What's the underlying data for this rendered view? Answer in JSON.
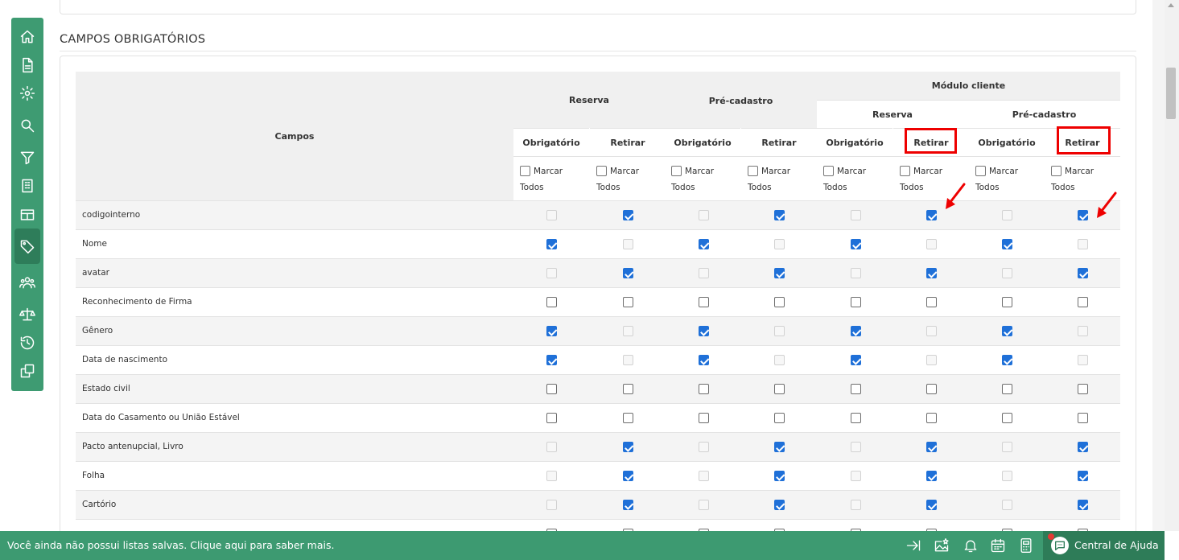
{
  "section": {
    "title": "CAMPOS OBRIGATÓRIOS"
  },
  "table": {
    "campos_header": "Campos",
    "groups": {
      "reserva": "Reserva",
      "pre_cadastro": "Pré-cadastro",
      "modulo_cliente": "Módulo cliente",
      "mc_reserva": "Reserva",
      "mc_pre_cadastro": "Pré-cadastro"
    },
    "sub_headers": [
      "Obrigatório",
      "Retirar",
      "Obrigatório",
      "Retirar",
      "Obrigatório",
      "Retirar",
      "Obrigatório",
      "Retirar"
    ],
    "mark_all": {
      "line1": "Marcar",
      "line2": "Todos"
    },
    "rows": [
      {
        "label": "codigointerno",
        "states": [
          "d",
          "c",
          "d",
          "c",
          "d",
          "c",
          "d",
          "c"
        ]
      },
      {
        "label": "Nome",
        "states": [
          "c",
          "d",
          "c",
          "d",
          "c",
          "d",
          "c",
          "d"
        ]
      },
      {
        "label": "avatar",
        "states": [
          "d",
          "c",
          "d",
          "c",
          "d",
          "c",
          "d",
          "c"
        ]
      },
      {
        "label": "Reconhecimento de Firma",
        "states": [
          "u",
          "u",
          "u",
          "u",
          "u",
          "u",
          "u",
          "u"
        ]
      },
      {
        "label": "Gênero",
        "states": [
          "c",
          "d",
          "c",
          "d",
          "c",
          "d",
          "c",
          "d"
        ]
      },
      {
        "label": "Data de nascimento",
        "states": [
          "c",
          "d",
          "c",
          "d",
          "c",
          "d",
          "c",
          "d"
        ]
      },
      {
        "label": "Estado civil",
        "states": [
          "u",
          "u",
          "u",
          "u",
          "u",
          "u",
          "u",
          "u"
        ]
      },
      {
        "label": "Data do Casamento ou União Estável",
        "states": [
          "u",
          "u",
          "u",
          "u",
          "u",
          "u",
          "u",
          "u"
        ]
      },
      {
        "label": "Pacto antenupcial, Livro",
        "states": [
          "d",
          "c",
          "d",
          "c",
          "d",
          "c",
          "d",
          "c"
        ]
      },
      {
        "label": "Folha",
        "states": [
          "d",
          "c",
          "d",
          "c",
          "d",
          "c",
          "d",
          "c"
        ]
      },
      {
        "label": "Cartório",
        "states": [
          "d",
          "c",
          "d",
          "c",
          "d",
          "c",
          "d",
          "c"
        ]
      },
      {
        "label": "",
        "states": [
          "u",
          "u",
          "u",
          "u",
          "u",
          "u",
          "u",
          "u"
        ]
      }
    ]
  },
  "sidebar": {
    "icons": [
      "home-icon",
      "document-icon",
      "gear-icon",
      "search-icon",
      "filter-icon",
      "building-icon",
      "table-icon",
      "tag-icon",
      "users-icon",
      "scale-icon",
      "history-icon",
      "copy-icon"
    ]
  },
  "bottombar": {
    "message": "Você ainda não possui listas salvas. Clique aqui para saber mais.",
    "help_label": "Central de Ajuda"
  },
  "colors": {
    "brand": "#3e9b72",
    "checkbox": "#1f70d8",
    "highlight": "#ee0000"
  }
}
